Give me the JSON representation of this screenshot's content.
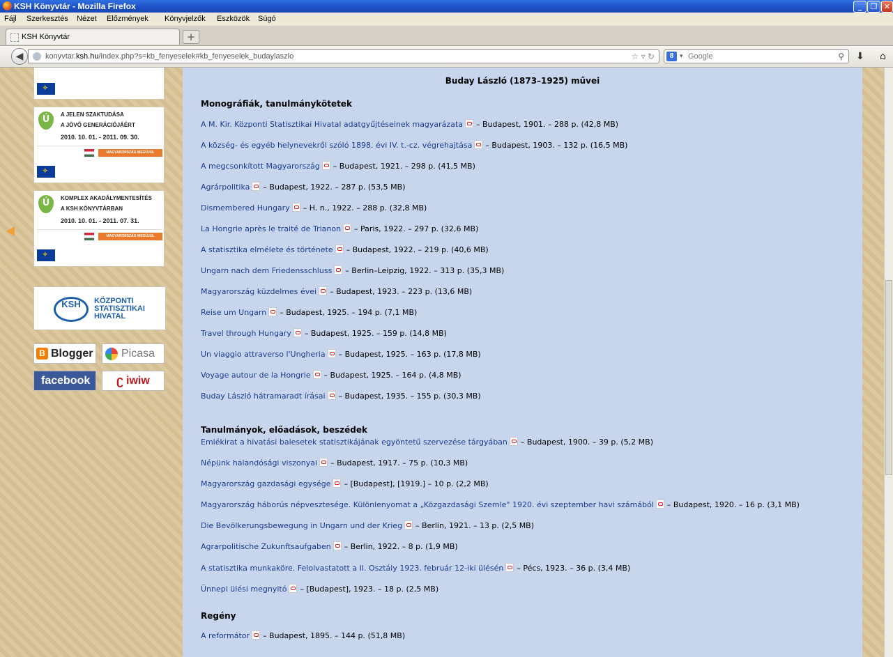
{
  "window": {
    "title": "KSH Könyvtár - Mozilla Firefox"
  },
  "menu": [
    "Fájl",
    "Szerkesztés",
    "Nézet",
    "Előzmények",
    "Könyvjelzők",
    "Eszközök",
    "Súgó"
  ],
  "tab": {
    "label": "KSH Könyvtár",
    "new_tab": "+"
  },
  "nav": {
    "url_prefix": "konyvtar.",
    "url_domain": "ksh.hu",
    "url_path": "/index.php?s=kb_fenyeselek#kb_fenyeselek_budaylaszlo",
    "search_engine_icon": "8",
    "search_placeholder": "Google"
  },
  "sidebar": {
    "banner1": {
      "line1": "A JELEN SZAKTUDÁSA",
      "line2": "A JÖVŐ GENERÁCIÓJÁÉRT",
      "dates": "2010. 10. 01. - 2011. 09. 30.",
      "badge": "MAGYARORSZÁG MEGÚJUL"
    },
    "banner2": {
      "line1": "KOMPLEX AKADÁLYMENTESÍTÉS",
      "line2": "A KSH KÖNYVTÁRBAN",
      "dates": "2010. 10. 01. - 2011. 07. 31.",
      "badge": "MAGYARORSZÁG MEGÚJUL"
    },
    "ksh": {
      "abbr": "KSH",
      "line1": "KÖZPONTI",
      "line2": "STATISZTIKAI",
      "line3": "HIVATAL"
    },
    "social": {
      "blogger": "Blogger",
      "picasa": "Picasa",
      "facebook": "facebook",
      "iwiw": "iwiw"
    }
  },
  "content": {
    "heading": "Buday László (1873–1925) művei",
    "sections": [
      {
        "title": "Monográfiák, tanulmánykötetek",
        "items": [
          {
            "title": "A M. Kir. Központi Statisztikai Hivatal adatgyűjtéseinek magyarázata",
            "meta": "– Budapest, 1901. – 288 p. (42,8 MB)"
          },
          {
            "title": "A község- és egyéb helynevekről szóló 1898. évi IV. t.-cz. végrehajtása",
            "meta": "– Budapest, 1903. – 132 p. (16,5 MB)"
          },
          {
            "title": "A megcsonkított Magyarország",
            "meta": "– Budapest, 1921. – 298 p. (41,5 MB)"
          },
          {
            "title": "Agrárpolitika",
            "meta": "– Budapest, 1922. – 287 p. (53,5 MB)"
          },
          {
            "title": "Dismembered Hungary",
            "meta": "– H. n., 1922. – 288 p. (32,8 MB)"
          },
          {
            "title": "La Hongrie après le traité de Trianon",
            "meta": "– Paris, 1922. – 297 p. (32,6 MB)"
          },
          {
            "title": "A statisztika elmélete és története",
            "meta": "– Budapest, 1922. – 219 p. (40,6 MB)"
          },
          {
            "title": "Ungarn nach dem Friedensschluss",
            "meta": "– Berlin–Leipzig, 1922. – 313 p. (35,3 MB)"
          },
          {
            "title": "Magyarország küzdelmes évei",
            "meta": "– Budapest, 1923. – 223 p. (13,6 MB)"
          },
          {
            "title": "Reise um Ungarn",
            "meta": "– Budapest, 1925. – 194 p. (7,1 MB)"
          },
          {
            "title": "Travel through Hungary",
            "meta": "– Budapest, 1925. – 159 p. (14,8 MB)"
          },
          {
            "title": "Un viaggio attraverso l'Ungheria",
            "meta": "– Budapest, 1925. – 163 p. (17,8 MB)"
          },
          {
            "title": "Voyage autour de la Hongrie",
            "meta": "– Budapest, 1925. – 164 p. (4,8 MB)"
          },
          {
            "title": "Buday László hátramaradt írásai",
            "meta": "– Budapest, 1935. – 155 p. (30,3 MB)"
          }
        ]
      },
      {
        "title": "Tanulmányok, előadások, beszédek",
        "items": [
          {
            "title": "Emlékirat a hivatási balesetek statisztikájának egyöntetű szervezése tárgyában",
            "meta": "– Budapest, 1900. – 39 p. (5,2 MB)"
          },
          {
            "title": "Népünk halandósági viszonyai",
            "meta": "– Budapest, 1917. – 75 p. (10,3 MB)"
          },
          {
            "title": "Magyarország gazdasági egysége",
            "meta": "– [Budapest], [1919.] – 10 p. (2,2 MB)"
          },
          {
            "title": "Magyarország háborús népvesztesége. Különlenyomat a „Közgazdasági Szemle\" 1920. évi szeptember havi számából",
            "meta": "– Budapest, 1920. – 16 p. (3,1 MB)"
          },
          {
            "title": "Die Bevölkerungsbewegung in Ungarn und der Krieg",
            "meta": "– Berlin, 1921. – 13 p. (2,5 MB)"
          },
          {
            "title": "Agrarpolitische Zukunftsaufgaben",
            "meta": "– Berlin, 1922. – 8 p. (1,9 MB)"
          },
          {
            "title": "A statisztika munkaköre. Felolvastatott a II. Osztály 1923. február 12-iki ülésén",
            "meta": "– Pécs, 1923. – 36 p. (3,4 MB)"
          },
          {
            "title": "Ünnepi ülési megnyitó",
            "meta": "– [Budapest], 1923. – 18 p. (2,5 MB)"
          }
        ]
      },
      {
        "title": "Regény",
        "items": [
          {
            "title": "A reformátor",
            "meta": "– Budapest, 1895. – 144 p. (51,8 MB)"
          }
        ]
      }
    ]
  }
}
